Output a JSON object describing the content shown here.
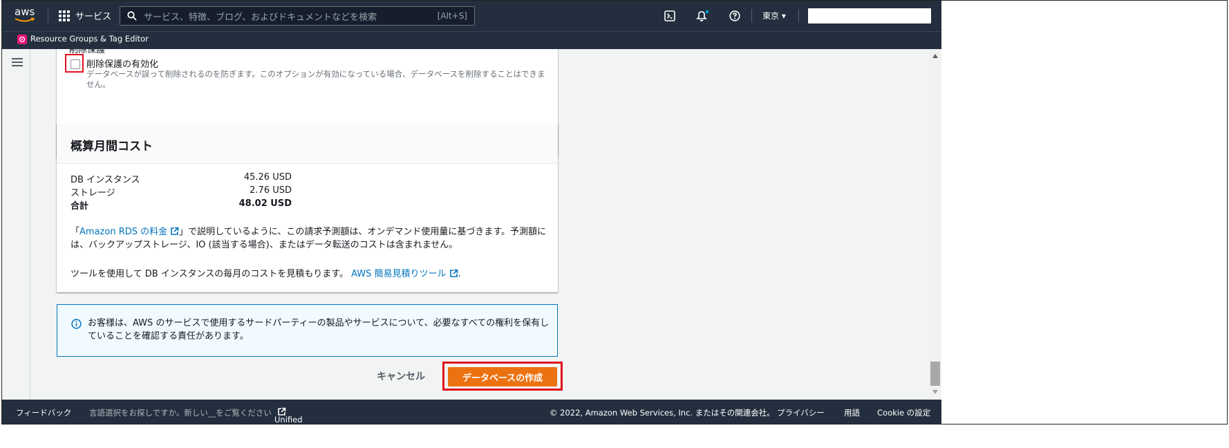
{
  "topnav": {
    "logo_text": "aws",
    "services_label": "サービス",
    "search_placeholder": "サービス、特徴、ブログ、およびドキュメントなどを検索",
    "search_shortcut": "[Alt+S]",
    "region": "東京 ▾",
    "icons": [
      "cloudshell-icon",
      "bell-icon",
      "help-icon"
    ]
  },
  "subnav": {
    "resource_groups_label": "Resource Groups & Tag Editor"
  },
  "deletion_protection": {
    "section_label_cut": "削除保護",
    "checkbox_label": "削除保護の有効化",
    "description": "データベースが誤って削除されるのを防ぎます。このオプションが有効になっている場合、データベースを削除することはできません。",
    "checked": false
  },
  "cost": {
    "title": "概算月間コスト",
    "rows": [
      {
        "label": "DB インスタンス",
        "value": "45.26 USD"
      },
      {
        "label": "ストレージ",
        "value": "2.76 USD"
      },
      {
        "label": "合計",
        "value": "48.02 USD"
      }
    ],
    "note_prefix": "「",
    "note_link": "Amazon RDS の料金",
    "note_suffix": "」で説明しているように、この請求予測額は、オンデマンド使用量に基づきます。予測額には、バックアップストレージ、IO (該当する場合)、またはデータ転送のコストは含まれません。",
    "tool_text": "ツールを使用して DB インスタンスの毎月のコストを見積もります。",
    "tool_link": "AWS 簡易見積りツール",
    "tool_suffix": "."
  },
  "info": {
    "text": "お客様は、AWS のサービスで使用するサードパーティーの製品やサービスについて、必要なすべての権利を保有していることを確認する責任があります。"
  },
  "actions": {
    "cancel_label": "キャンセル",
    "create_label": "データベースの作成"
  },
  "footer": {
    "feedback": "フィードバック",
    "language_prompt": "言語選択をお探しですか。新しい__をご覧ください",
    "unified_settings": "Unified Settings",
    "copyright": "© 2022, Amazon Web Services, Inc. またはその関連会社。",
    "privacy": "プライバシー",
    "terms": "用語",
    "cookie": "Cookie の設定"
  },
  "colors": {
    "nav_bg": "#232f3e",
    "primary_button": "#ec7211",
    "link": "#0073bb",
    "highlight": "#e0101d"
  }
}
